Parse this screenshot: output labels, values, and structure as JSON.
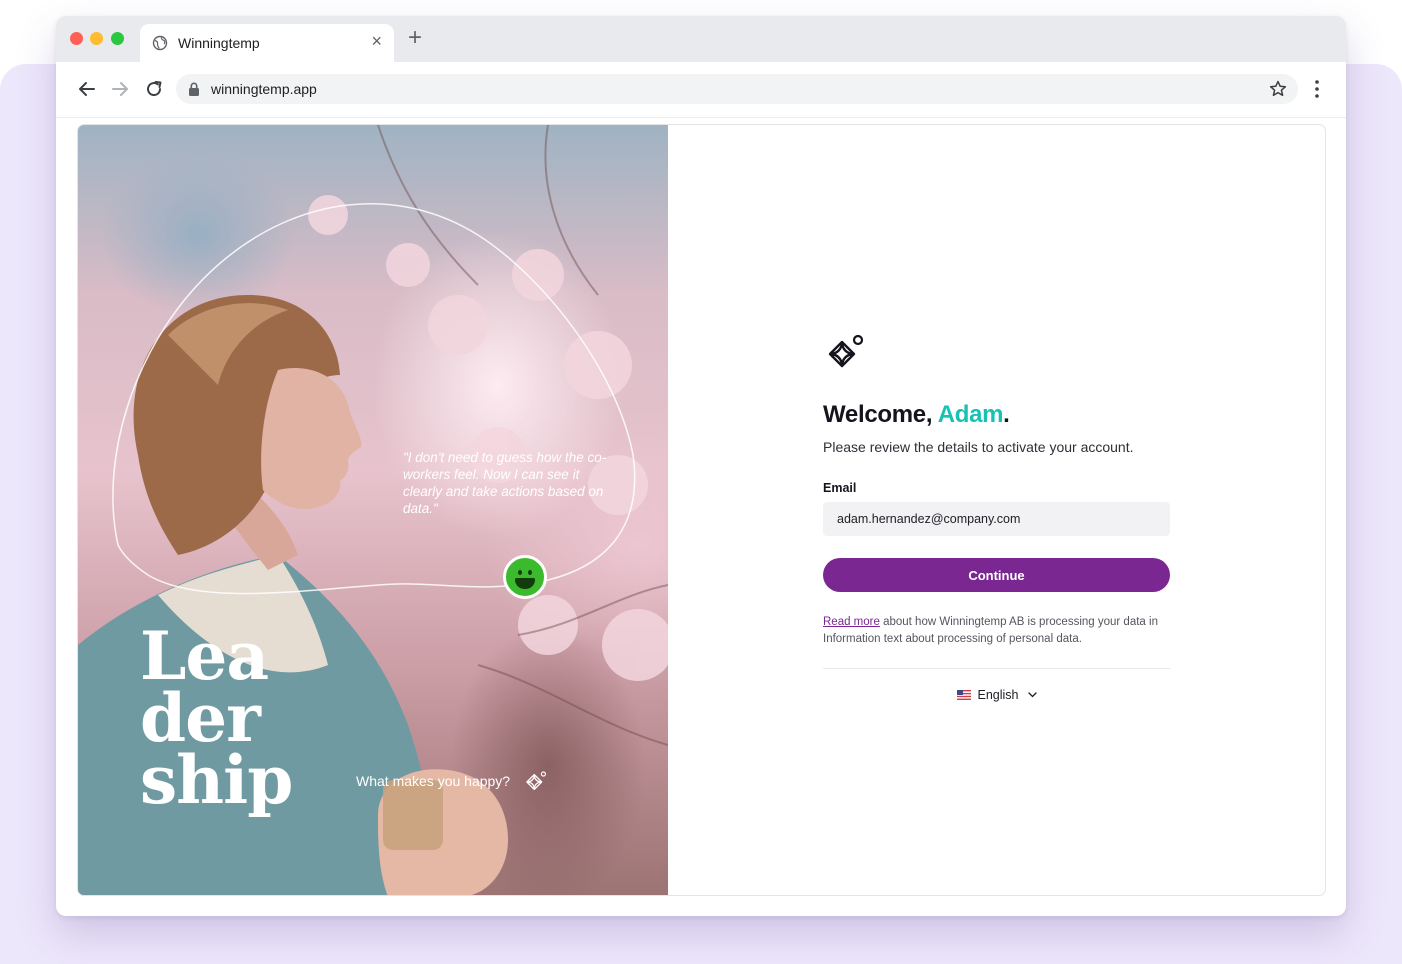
{
  "browser": {
    "tab_title": "Winningtemp",
    "tab_close": "×",
    "new_tab": "+",
    "url": "winningtemp.app"
  },
  "hero": {
    "quote": "\"I don't need to guess how the co-workers feel. Now I can see it clearly and take actions based on data.\"",
    "big_word_lines": [
      "Lea",
      "der",
      "ship"
    ],
    "tagline": "What makes you happy?"
  },
  "form": {
    "welcome_prefix": "Welcome, ",
    "user_name": "Adam",
    "welcome_suffix": ".",
    "subtitle": "Please review the details to activate your account.",
    "email_label": "Email",
    "email_value": "adam.hernandez@company.com",
    "continue_label": "Continue",
    "privacy_link": "Read more",
    "privacy_text": " about how Winningtemp AB is processing your data in Information text about processing of personal data.",
    "language": "English"
  },
  "colors": {
    "accent_name": "#17c1b4",
    "primary_button": "#7b2791",
    "background": "#ede7fb"
  },
  "icons": [
    "globe-icon",
    "close-icon",
    "plus-icon",
    "back-arrow-icon",
    "forward-arrow-icon",
    "reload-icon",
    "lock-icon",
    "star-icon",
    "menu-dots-icon",
    "winningtemp-logo-icon",
    "smiley-icon",
    "us-flag-icon",
    "chevron-down-icon"
  ]
}
